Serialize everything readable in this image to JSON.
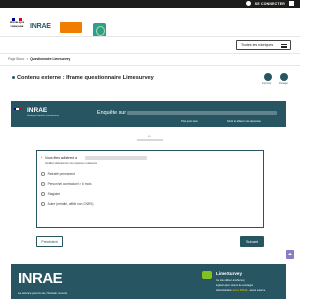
{
  "topbar": {
    "login_label": "SE CONNECTER"
  },
  "header": {
    "rf_logo_text": [
      "RÉPUBLIQUE",
      "FRANÇAISE"
    ],
    "inrae_logo": "INRAE",
    "orange_logo_text": "",
    "themes_button": "Toutes les rubriques"
  },
  "breadcrumb": {
    "items": [
      "Page Blanc",
      "Questionnaire Limesurvey"
    ],
    "separator": ">"
  },
  "page": {
    "title": "Contenu externe : Iframe questionnaire Limesurvey",
    "print_label": "Imprimer",
    "share_label": "Partager"
  },
  "survey_header": {
    "logo": "INRAE",
    "logo_sub": "Sondages Enquêtes Questionnaires",
    "title": "Enquête sur",
    "link_first_time": "Titre pour tous",
    "link_clear": "Sortir et effacer vos réponses"
  },
  "progress": {
    "label": "0%",
    "value": 0
  },
  "question": {
    "mandatory_mark": "*",
    "text": "Vous êtes adhérent à",
    "help": "Veuillez sélectionner une réponse ci-dessous",
    "options": [
      "Retraité permanent",
      "Personnel contractuel > 6 mois",
      "Stagiaire",
      "Autre (retraité, affilié non CNRS)"
    ]
  },
  "nav": {
    "prev_label": "Précédent",
    "next_label": "Suivant"
  },
  "footer": {
    "logo": "INRAE",
    "slogan": "La science pour la vie, l'humain, la terre",
    "ls_title": "LimeSurvey",
    "line1": "Ce site utilise LimeSurvey",
    "line2": "logiciel open source de sondages",
    "line3_prefix": "Administration",
    "line3_highlight": "accès INRAE",
    "line3_suffix": "· accès externe"
  },
  "colors": {
    "brand": "#275662",
    "accent_orange": "#f07d02",
    "scroll_btn": "#8c7ac6"
  }
}
